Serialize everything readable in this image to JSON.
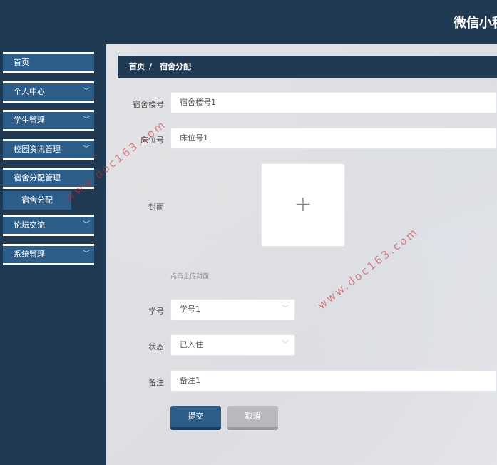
{
  "header": {
    "title": "微信小程"
  },
  "sidebar": {
    "items": [
      {
        "label": "首页",
        "has_chevron": false
      },
      {
        "label": "个人中心",
        "has_chevron": true
      },
      {
        "label": "学生管理",
        "has_chevron": true
      },
      {
        "label": "校园资讯管理",
        "has_chevron": true
      },
      {
        "label": "宿舍分配管理",
        "has_chevron": false
      },
      {
        "label": "论坛交流",
        "has_chevron": true
      },
      {
        "label": "系统管理",
        "has_chevron": true
      }
    ],
    "sub_items": [
      {
        "label": "宿舍分配"
      }
    ]
  },
  "breadcrumb": {
    "home": "首页",
    "separator": "/",
    "current": "宿舍分配"
  },
  "form": {
    "building": {
      "label": "宿舍楼号",
      "placeholder": "宿舍楼号1"
    },
    "bed": {
      "label": "床位号",
      "placeholder": "床位号1"
    },
    "cover": {
      "label": "封面",
      "hint": "点击上传封面"
    },
    "student_id": {
      "label": "学号",
      "value": "学号1"
    },
    "status": {
      "label": "状态",
      "value": "已入住"
    },
    "remark": {
      "label": "备注",
      "placeholder": "备注1"
    }
  },
  "buttons": {
    "submit": "提交",
    "cancel": "取消"
  },
  "watermark": "www.doc163.com",
  "colors": {
    "primary": "#2d5e89",
    "dark": "#1f3a52",
    "cancel": "#b8b9bc"
  }
}
